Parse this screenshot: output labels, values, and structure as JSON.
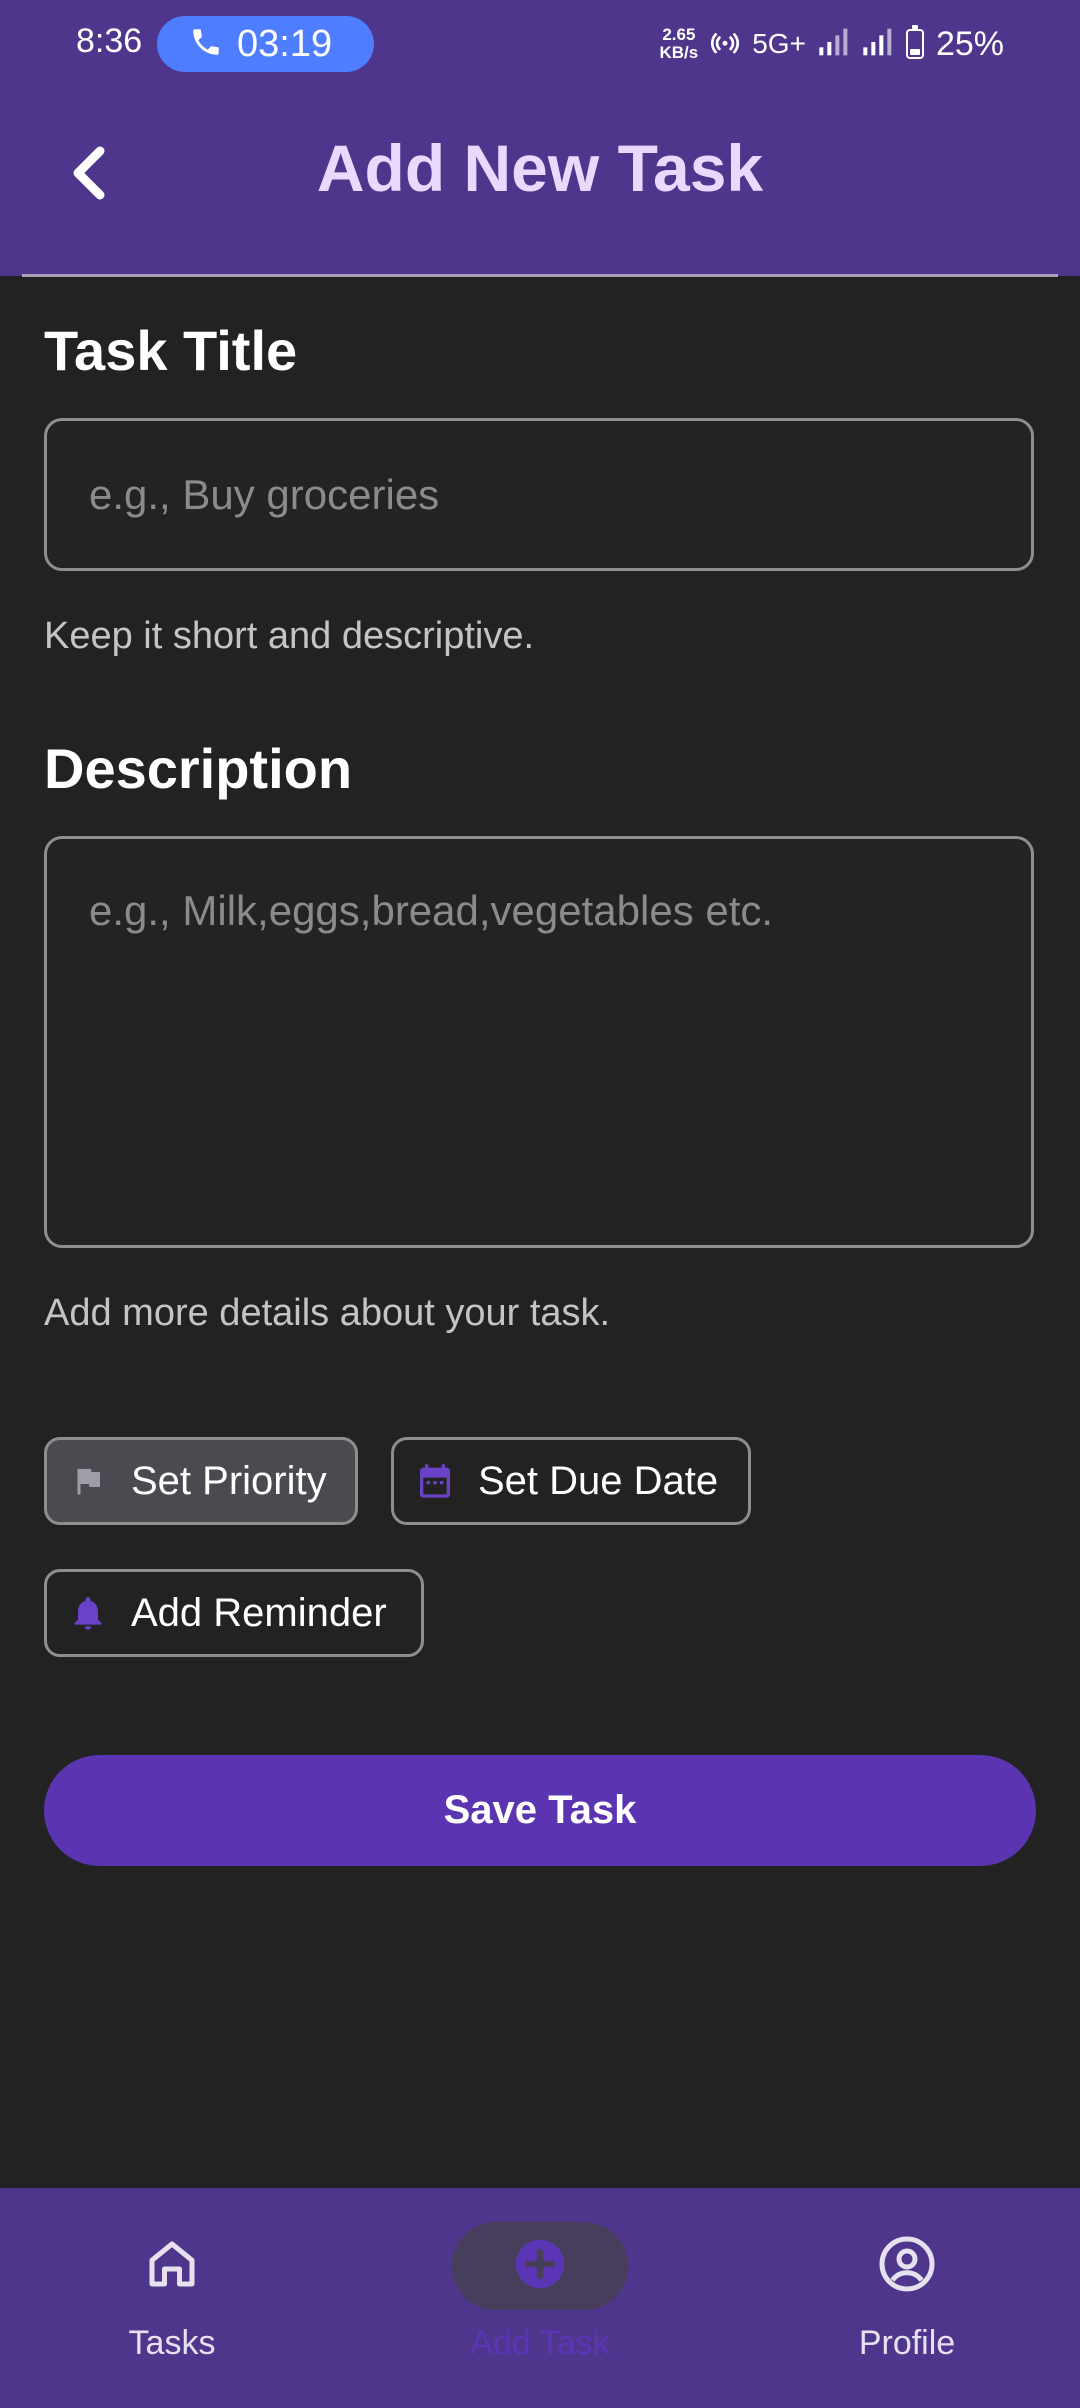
{
  "status_bar": {
    "time": "8:36",
    "call_timer": "03:19",
    "net_speed_value": "2.65",
    "net_speed_unit": "KB/s",
    "network_type": "5G+",
    "battery": "25%"
  },
  "header": {
    "title": "Add New Task"
  },
  "form": {
    "title_label": "Task Title",
    "title_placeholder": "e.g., Buy groceries",
    "title_value": "",
    "title_helper": "Keep it short and descriptive.",
    "description_label": "Description",
    "description_placeholder": "e.g., Milk,eggs,bread,vegetables etc.",
    "description_value": "",
    "description_helper": "Add more details about your task."
  },
  "chips": {
    "priority_label": "Set Priority",
    "due_date_label": "Set Due Date",
    "reminder_label": "Add Reminder"
  },
  "actions": {
    "save_label": "Save Task"
  },
  "bottom_nav": {
    "tasks_label": "Tasks",
    "add_task_label": "Add Task",
    "profile_label": "Profile",
    "active": "add_task"
  },
  "colors": {
    "header_bg": "#4e368c",
    "accent": "#5b35b1",
    "title_text": "#ead9ff",
    "background": "#222222"
  }
}
